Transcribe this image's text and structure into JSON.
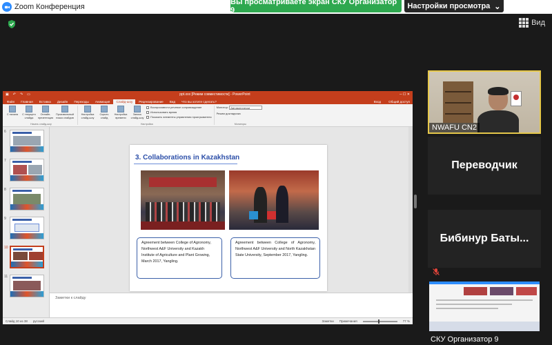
{
  "window": {
    "title": "Zoom Конференция"
  },
  "banner": {
    "sharing_text": "Вы просматриваете экран СКУ Организатор 9",
    "view_settings_label": "Настройки просмотра"
  },
  "toolbar": {
    "view_label": "Вид"
  },
  "powerpoint": {
    "title": "ppt.xxx [Режим совместимости] - PowerPoint",
    "tabs": [
      "Файл",
      "Главная",
      "Вставка",
      "Дизайн",
      "Переходы",
      "Анимация",
      "Слайд-шоу",
      "Рецензирование",
      "Вид"
    ],
    "active_tab": "Слайд-шоу",
    "tell_me": "Что вы хотите сделать?",
    "right_links": [
      "Вход",
      "Общий доступ"
    ],
    "ribbon": {
      "start_buttons": [
        "С начала",
        "С текущего слайда",
        "Онлайн-презентация",
        "Произвольный показ слайдов"
      ],
      "start_group": "Начать слайд-шоу",
      "setup_buttons": [
        "Настройка слайд-шоу",
        "Скрыть слайд",
        "Настройка времени",
        "Запись слайд-шоу"
      ],
      "checks": [
        "Воспроизвести речевое сопровождение",
        "Использовать время",
        "Показать элементы управления проигрывателя"
      ],
      "setup_group": "Настройка",
      "monitor_label": "Монитор:",
      "monitor_value": "Автоматически",
      "presenter_view": "Режим докладчика",
      "monitor_group": "Мониторы"
    },
    "thumbnails": [
      "6",
      "7",
      "8",
      "9",
      "10",
      "11"
    ],
    "active_thumbnail": "10",
    "slide": {
      "title": "3. Collaborations in Kazakhstan",
      "caption_left": "Agreement between College of Agronomy, Northwest A&F University and Kazakh Institute of Agriculture and Plant Growing, March 2017, Yangling.",
      "caption_right": "Agreement between College of Agronomy, Northwest A&F University and North Kazakhstan State University, September 2017, Yangling."
    },
    "notes_placeholder": "Заметки к слайду",
    "status": {
      "slide": "Слайд 10 из 38",
      "lang": "русский",
      "notes": "Заметки",
      "comments": "Примечания",
      "zoom": "77 %"
    }
  },
  "participants": [
    {
      "name": "NWAFU CN2"
    },
    {
      "name": "Переводчик"
    },
    {
      "name": "Бибинур  Баты..."
    },
    {
      "name": "СКУ Организатор 9"
    }
  ],
  "colors": {
    "share_green": "#2ea84f",
    "ppt_red": "#c43e1c",
    "zoom_blue": "#2D8CFF",
    "active_speaker": "#e6c84a"
  }
}
